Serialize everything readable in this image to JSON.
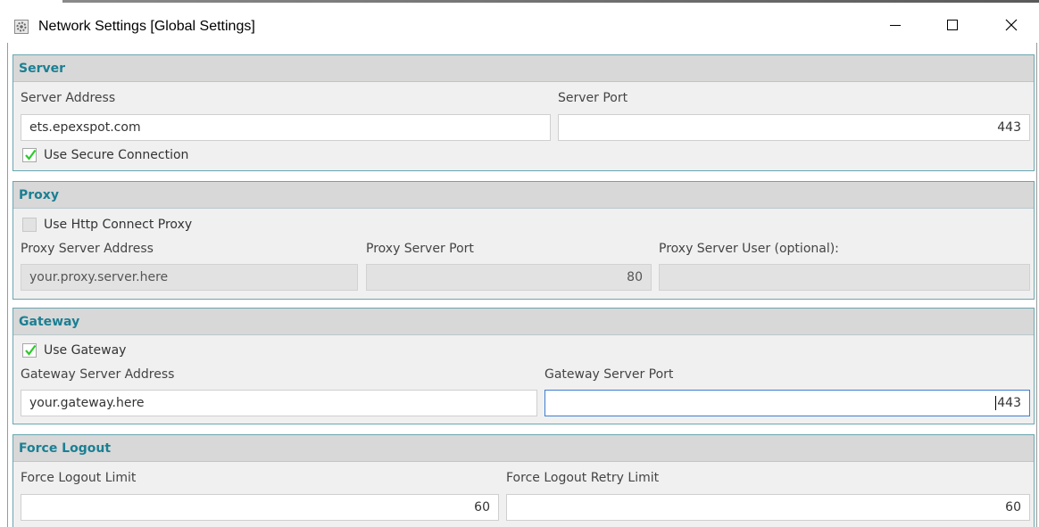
{
  "window": {
    "title": "Network Settings [Global Settings]"
  },
  "server": {
    "heading": "Server",
    "address_label": "Server Address",
    "address_value": "ets.epexspot.com",
    "port_label": "Server Port",
    "port_value": "443",
    "secure_label": "Use Secure Connection",
    "secure_checked": true
  },
  "proxy": {
    "heading": "Proxy",
    "use_label": "Use Http Connect Proxy",
    "use_checked": false,
    "address_label": "Proxy Server Address",
    "address_value": "your.proxy.server.here",
    "port_label": "Proxy Server Port",
    "port_value": "80",
    "user_label": "Proxy Server User (optional):",
    "user_value": ""
  },
  "gateway": {
    "heading": "Gateway",
    "use_label": "Use Gateway",
    "use_checked": true,
    "address_label": "Gateway Server Address",
    "address_value": "your.gateway.here",
    "port_label": "Gateway Server Port",
    "port_value": "443"
  },
  "force_logout": {
    "heading": "Force Logout",
    "limit_label": "Force Logout Limit",
    "limit_value": "60",
    "retry_label": "Force Logout Retry Limit",
    "retry_value": "60"
  },
  "colors": {
    "heading": "#1b7f93",
    "group_border": "#6aa6b0",
    "check": "#2ec92e",
    "focus": "#3c7fd0"
  }
}
